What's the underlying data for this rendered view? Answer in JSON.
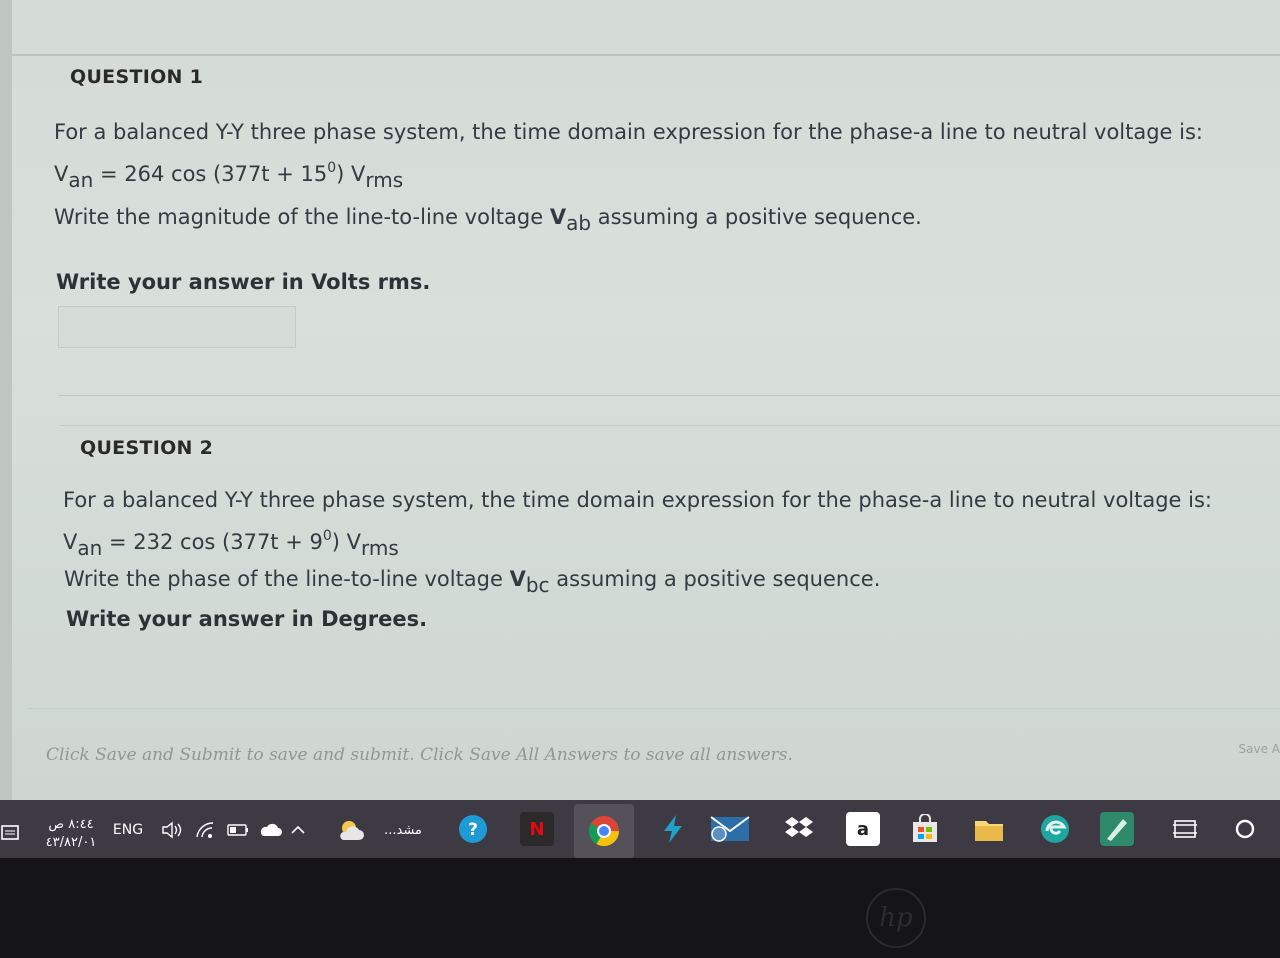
{
  "question1": {
    "title": "QUESTION 1",
    "intro": "For a balanced Y-Y three phase system, the time domain expression for the phase-a line to neutral voltage is:",
    "eq_v": "V",
    "eq_sub": "an",
    "eq_main": " = 264 cos (377t + 15",
    "eq_sup": "0",
    "eq_close": ") V",
    "eq_unit": "rms",
    "ask_pre": "Write the magnitude of the line-to-line voltage ",
    "ask_v": "V",
    "ask_sub": "ab",
    "ask_post": " assuming a positive sequence.",
    "instruction": "Write your answer in Volts rms.",
    "answer_value": ""
  },
  "question2": {
    "title": "QUESTION 2",
    "intro": "For a balanced Y-Y three phase system, the time domain expression for the phase-a line to neutral voltage is:",
    "eq_v": "V",
    "eq_sub": "an",
    "eq_main": " = 232 cos (377t + 9",
    "eq_sup": "0",
    "eq_close": ") V",
    "eq_unit": "rms",
    "ask_pre": "Write the phase of the line-to-line voltage ",
    "ask_v": "V",
    "ask_sub": "bc",
    "ask_post": "  assuming a positive sequence.",
    "instruction": "Write your answer in Degrees."
  },
  "footer": {
    "text": "Click Save and Submit to save and submit. Click Save All Answers to save all answers.",
    "save_all": "Save A"
  },
  "taskbar": {
    "time": "٨:٤٤ ص",
    "date": "٤٣/٨٢/٠١",
    "language": "ENG",
    "search_label": "...مشد",
    "amazon_label": "a",
    "netflix_label": "N"
  },
  "device": {
    "brand": "hp"
  }
}
